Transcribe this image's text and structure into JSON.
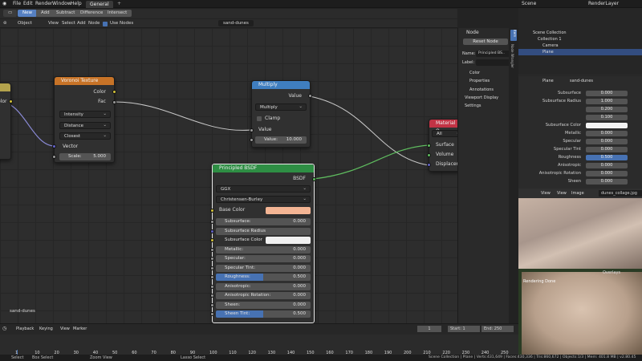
{
  "topbar": {
    "menus": [
      "File",
      "Edit",
      "Render",
      "Window",
      "Help"
    ],
    "workspace_tab": "General",
    "scene_label": "Scene",
    "view_layer": "RenderLayer"
  },
  "mode_buttons": [
    "New",
    "Add",
    "Subtract",
    "Difference",
    "Intersect"
  ],
  "editor_header": {
    "object": "Object",
    "menus": [
      "View",
      "Select",
      "Add",
      "Node"
    ],
    "use_nodes": "Use Nodes",
    "material": "sand-dunes"
  },
  "colors": {
    "accent": "#5680c2",
    "voronoi": "#c77327",
    "multiply": "#3f7ec0",
    "bsdf": "#2e8e44",
    "output": "#c23345",
    "base_color": "#f4b594"
  },
  "partial_left_node": {
    "label_fragment": "olor"
  },
  "voronoi": {
    "title": "Voronoi Texture",
    "out_color": "Color",
    "out_fac": "Fac",
    "opt1": "Intensity",
    "opt2": "Distance",
    "opt3": "Closest",
    "vector": "Vector",
    "scale_label": "Scale:",
    "scale_value": "5.000"
  },
  "multiply": {
    "title": "Multiply",
    "out": "Value",
    "op": "Multiply",
    "clamp": "Clamp",
    "in": "Value",
    "value_label": "Value:",
    "value": "10.000"
  },
  "bsdf": {
    "title": "Principled BSDF",
    "out": "BSDF",
    "dist": "GGX",
    "sss_method": "Christensen-Burley",
    "base_color": "Base Color",
    "rows": [
      {
        "label": "Subsurface:",
        "value": "0.000",
        "fill": 0
      },
      {
        "label": "Subsurface Radius",
        "value": "",
        "fill": 0
      },
      {
        "label": "Subsurface Color",
        "value": "",
        "fill": 0
      },
      {
        "label": "Metallic:",
        "value": "0.000",
        "fill": 0
      },
      {
        "label": "Specular:",
        "value": "0.000",
        "fill": 0
      },
      {
        "label": "Specular Tint:",
        "value": "0.000",
        "fill": 0
      },
      {
        "label": "Roughness:",
        "value": "0.500",
        "fill": 0.5
      },
      {
        "label": "Anisotropic:",
        "value": "0.000",
        "fill": 0
      },
      {
        "label": "Anisotropic Rotation:",
        "value": "0.000",
        "fill": 0
      },
      {
        "label": "Sheen:",
        "value": "0.000",
        "fill": 0
      },
      {
        "label": "Sheen Tint:",
        "value": "0.500",
        "fill": 0.5
      }
    ]
  },
  "material_output": {
    "title": "Material O",
    "target": "All",
    "surface": "Surface",
    "volume": "Volume",
    "displacement": "Displacem"
  },
  "editor_footer_label": "sand-dunes",
  "npanel": {
    "section": "Node",
    "reset": "Reset Node",
    "name_label": "Name:",
    "name_value": "Principled BS..",
    "label_label": "Label:",
    "color": "Color",
    "properties": "Properties",
    "annotations": "Annotations",
    "viewport_display": "Viewport Display",
    "settings": "Settings",
    "tabs": [
      "Item",
      "Node Wrangler"
    ]
  },
  "outliner": {
    "items": [
      "Scene Collection",
      "Collection 1",
      "Camera",
      "Plane"
    ]
  },
  "props": {
    "object": "Plane",
    "material": "sand-dunes",
    "rows": [
      {
        "label": "Subsurface",
        "value": "0.000"
      },
      {
        "label": "Subsurface Radius",
        "value": "1.000"
      },
      {
        "label": "",
        "value": "0.200"
      },
      {
        "label": "",
        "value": "0.100"
      },
      {
        "label": "Subsurface Color",
        "value": ""
      },
      {
        "label": "Metallic",
        "value": "0.000"
      },
      {
        "label": "Specular",
        "value": "0.000"
      },
      {
        "label": "Specular Tint",
        "value": "0.000"
      },
      {
        "label": "Roughness",
        "value": "0.500"
      },
      {
        "label": "Anisotropic",
        "value": "0.000"
      },
      {
        "label": "Anisotropic Rotation",
        "value": "0.000"
      },
      {
        "label": "Sheen",
        "value": "0.000"
      }
    ]
  },
  "image_editor": {
    "menus": [
      "View",
      "View",
      "Image"
    ],
    "image_name": "dunes_collage.jpg"
  },
  "viewport": {
    "label": "Rendering Done",
    "overlays": "Overlays"
  },
  "timeline": {
    "menus": [
      "Playback",
      "Keying",
      "View",
      "Marker"
    ],
    "current": "1",
    "start_label": "Start:",
    "start": "1",
    "end_label": "End:",
    "end": "250",
    "ticks": [
      "1",
      "10",
      "20",
      "30",
      "40",
      "50",
      "60",
      "70",
      "80",
      "90",
      "100",
      "110",
      "120",
      "130",
      "140",
      "150",
      "160",
      "170",
      "180",
      "190",
      "200",
      "210",
      "220",
      "230",
      "240",
      "250"
    ]
  },
  "statusbar": {
    "select": "Select",
    "box_select": "Box Select",
    "zoom": "Zoom View",
    "lasso": "Lasso Select",
    "info": "Scene Collection | Plane | Verts:431,649 | Faces:430,336 | Tris:860,672 | Objects:1/3 | Mem: 401.8 MB | v2.80.45"
  }
}
